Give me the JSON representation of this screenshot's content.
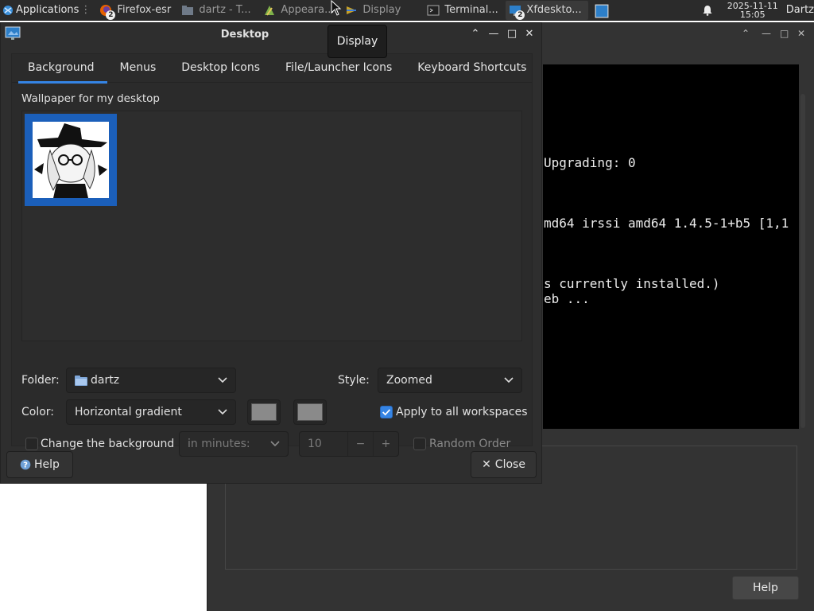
{
  "taskbar": {
    "apps_label": "Applications",
    "tasks": [
      {
        "label": "Firefox-esr",
        "badge": "2"
      },
      {
        "label": "dartz - T..."
      },
      {
        "label": "Appeara..."
      },
      {
        "label": "Display"
      },
      {
        "label": "Terminal..."
      },
      {
        "label": "Xfdeskto...",
        "badge": "2"
      }
    ],
    "clock_date": "2025-11-11",
    "clock_time": "15:05",
    "user": "Dartz"
  },
  "tooltip": "Display",
  "dialog": {
    "title": "Desktop",
    "tabs": [
      "Background",
      "Menus",
      "Desktop Icons",
      "File/Launcher Icons",
      "Keyboard Shortcuts"
    ],
    "active_tab": "Background",
    "wallpaper_label": "Wallpaper for my desktop",
    "folder_label": "Folder:",
    "folder_value": "dartz",
    "style_label": "Style:",
    "style_value": "Zoomed",
    "color_label": "Color:",
    "color_value": "Horizontal gradient",
    "apply_all_label": "Apply to all workspaces",
    "apply_all_checked": true,
    "change_bg_label": "Change the background",
    "change_bg_checked": false,
    "interval_value": "in minutes:",
    "interval_number": "10",
    "random_order_label": "Random Order",
    "random_order_checked": false,
    "help_label": "Help",
    "close_label": "Close"
  },
  "terminal": {
    "lines": [
      "Upgrading: 0",
      "md64 irssi amd64 1.4.5-1+b5 [1,1",
      "s currently installed.)",
      "eb ..."
    ]
  },
  "background_window": {
    "help_label": "Help"
  },
  "colors": {
    "accent": "#3584e4",
    "dialog_bg": "#2e2e2e",
    "terminal_bg": "#000000"
  }
}
